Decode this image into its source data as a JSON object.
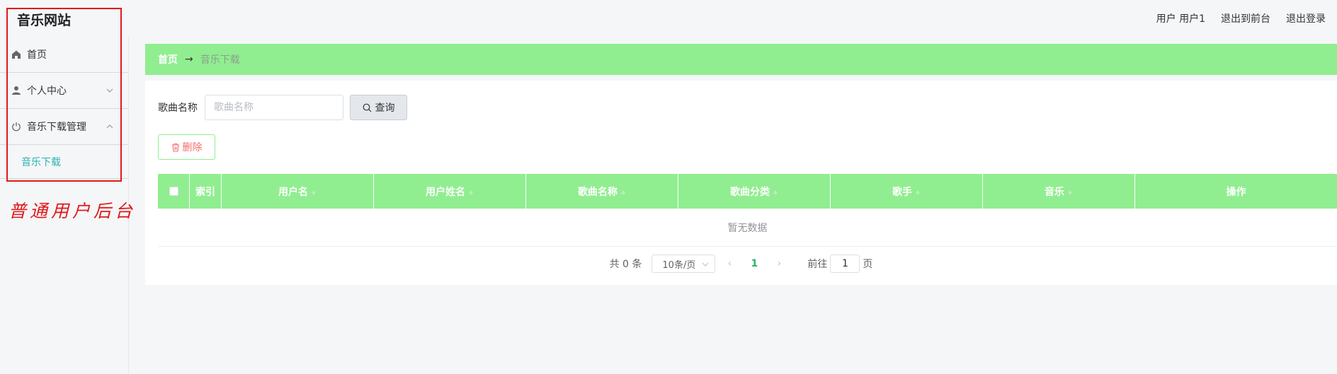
{
  "header": {
    "site_title": "音乐网站",
    "user_label": "用户 用户1",
    "back_to_front": "退出到前台",
    "logout": "退出登录"
  },
  "sidebar": {
    "items": [
      {
        "label": "首页",
        "icon": "home-icon"
      },
      {
        "label": "个人中心",
        "icon": "user-icon"
      },
      {
        "label": "音乐下载管理",
        "icon": "power-icon"
      }
    ],
    "submenu": [
      {
        "label": "音乐下载"
      }
    ]
  },
  "annotation": {
    "note": "普通用户后台",
    "color": "#e0191b"
  },
  "breadcrumb": {
    "home": "首页",
    "separator": "→",
    "current": "音乐下载"
  },
  "search": {
    "label": "歌曲名称",
    "placeholder": "歌曲名称",
    "query_button": "查询"
  },
  "toolbar": {
    "delete_button": "删除"
  },
  "table": {
    "columns": [
      "索引",
      "用户名",
      "用户姓名",
      "歌曲名称",
      "歌曲分类",
      "歌手",
      "音乐",
      "操作"
    ],
    "empty_text": "暂无数据"
  },
  "pagination": {
    "total": "共 0 条",
    "page_size": "10条/页",
    "prev": "‹",
    "current_page": "1",
    "next": "›",
    "goto_label": "前往",
    "goto_value": "1",
    "page_suffix": "页"
  },
  "colors": {
    "accent_green": "#90ee90",
    "link_teal": "#2bb3b0",
    "danger": "#f56c6c"
  }
}
